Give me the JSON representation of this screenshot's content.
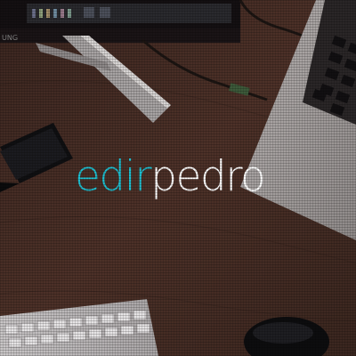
{
  "logo": {
    "part1": "edir",
    "part2": "pedro",
    "accent_color": "#1ec1d3",
    "secondary_color": "#ffffff"
  },
  "monitor": {
    "brand": "UNG"
  },
  "background": {
    "desk_color": "#4a3026",
    "overlay_tint": "#3a2a24"
  }
}
